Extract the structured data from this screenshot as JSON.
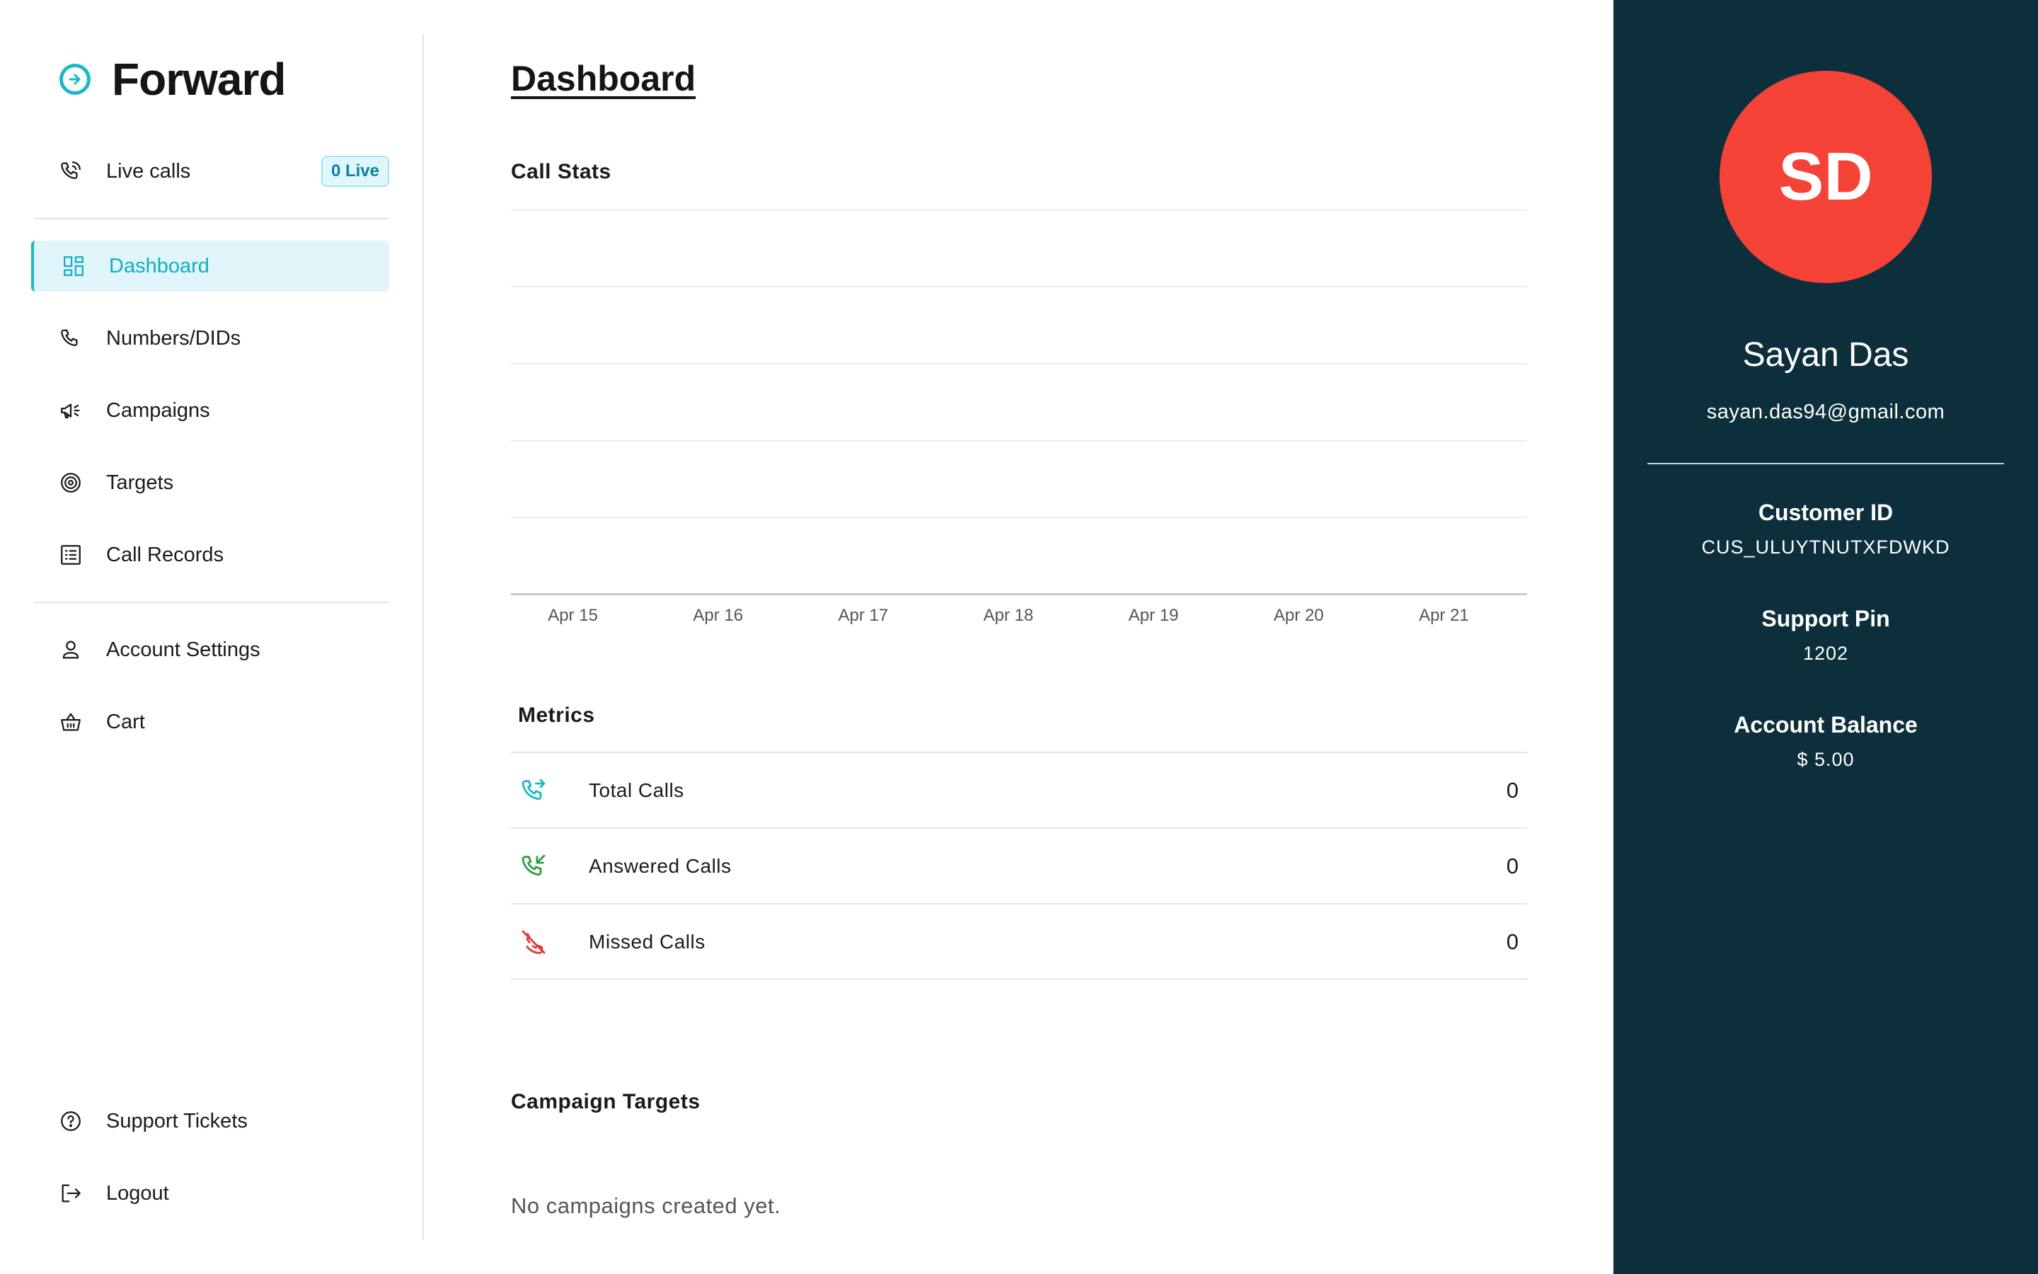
{
  "brand": {
    "name": "Forward"
  },
  "sidebar": {
    "live_calls": {
      "label": "Live calls",
      "badge": "0 Live"
    },
    "items": [
      {
        "label": "Dashboard",
        "icon": "dashboard-icon",
        "active": true
      },
      {
        "label": "Numbers/DIDs",
        "icon": "phone-icon"
      },
      {
        "label": "Campaigns",
        "icon": "megaphone-icon"
      },
      {
        "label": "Targets",
        "icon": "target-icon"
      },
      {
        "label": "Call Records",
        "icon": "list-icon"
      }
    ],
    "secondary": [
      {
        "label": "Account Settings",
        "icon": "user-icon"
      },
      {
        "label": "Cart",
        "icon": "basket-icon"
      }
    ],
    "bottom": [
      {
        "label": "Support Tickets",
        "icon": "help-circle-icon"
      },
      {
        "label": "Logout",
        "icon": "logout-icon"
      }
    ]
  },
  "main": {
    "title": "Dashboard",
    "call_stats_title": "Call Stats",
    "metrics_title": "Metrics",
    "metrics": [
      {
        "label": "Total Calls",
        "value": "0",
        "icon": "phone-forwarded-icon",
        "color": "#1ab8c9"
      },
      {
        "label": "Answered Calls",
        "value": "0",
        "icon": "phone-incoming-icon",
        "color": "#2e9e3e"
      },
      {
        "label": "Missed Calls",
        "value": "0",
        "icon": "phone-missed-icon",
        "color": "#e53935"
      }
    ],
    "campaign_targets_title": "Campaign Targets",
    "campaign_targets_empty": "No campaigns created yet."
  },
  "chart_data": {
    "type": "line",
    "title": "Call Stats",
    "categories": [
      "Apr 15",
      "Apr 16",
      "Apr 17",
      "Apr 18",
      "Apr 19",
      "Apr 20",
      "Apr 21"
    ],
    "series": [],
    "grid": true
  },
  "profile": {
    "initials": "SD",
    "name": "Sayan Das",
    "email": "sayan.das94@gmail.com",
    "customer_id_label": "Customer ID",
    "customer_id": "CUS_ULUYTNUTXFDWKD",
    "support_pin_label": "Support Pin",
    "support_pin": "1202",
    "balance_label": "Account Balance",
    "balance": "$ 5.00",
    "avatar_color": "#f44336",
    "panel_color": "#0d2f3c"
  },
  "colors": {
    "accent": "#1ab8c9"
  }
}
